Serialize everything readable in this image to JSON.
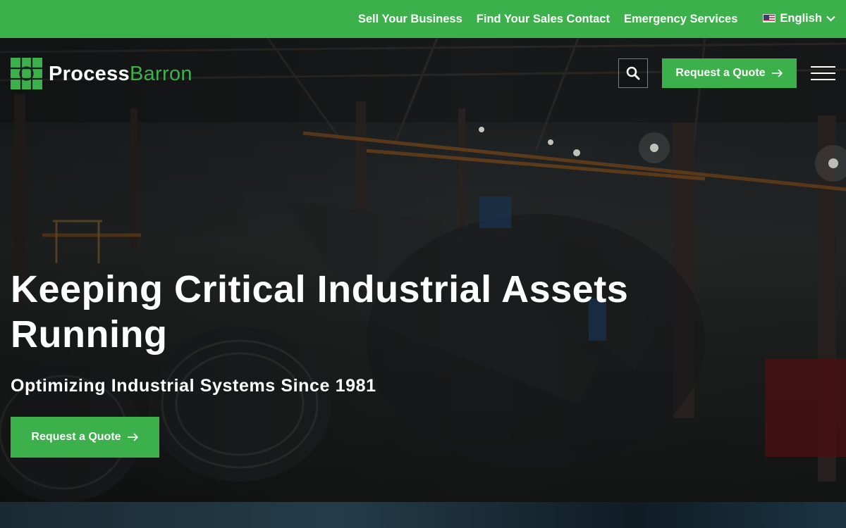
{
  "topbar": {
    "links": [
      "Sell Your Business",
      "Find Your Sales Contact",
      "Emergency Services"
    ],
    "language": "English"
  },
  "header": {
    "logo_primary": "Process",
    "logo_secondary": "Barron",
    "quote_label": "Request a Quote"
  },
  "hero": {
    "headline": "Keeping Critical Industrial Assets Running",
    "subheadline": "Optimizing Industrial Systems Since 1981",
    "cta_label": "Request a Quote"
  },
  "colors": {
    "brand_green": "#3cb04a",
    "text": "#ffffff"
  },
  "icons": [
    "flag-us-icon",
    "chevron-down-icon",
    "logo-mark-icon",
    "search-icon",
    "arrow-right-icon",
    "hamburger-menu-icon"
  ]
}
